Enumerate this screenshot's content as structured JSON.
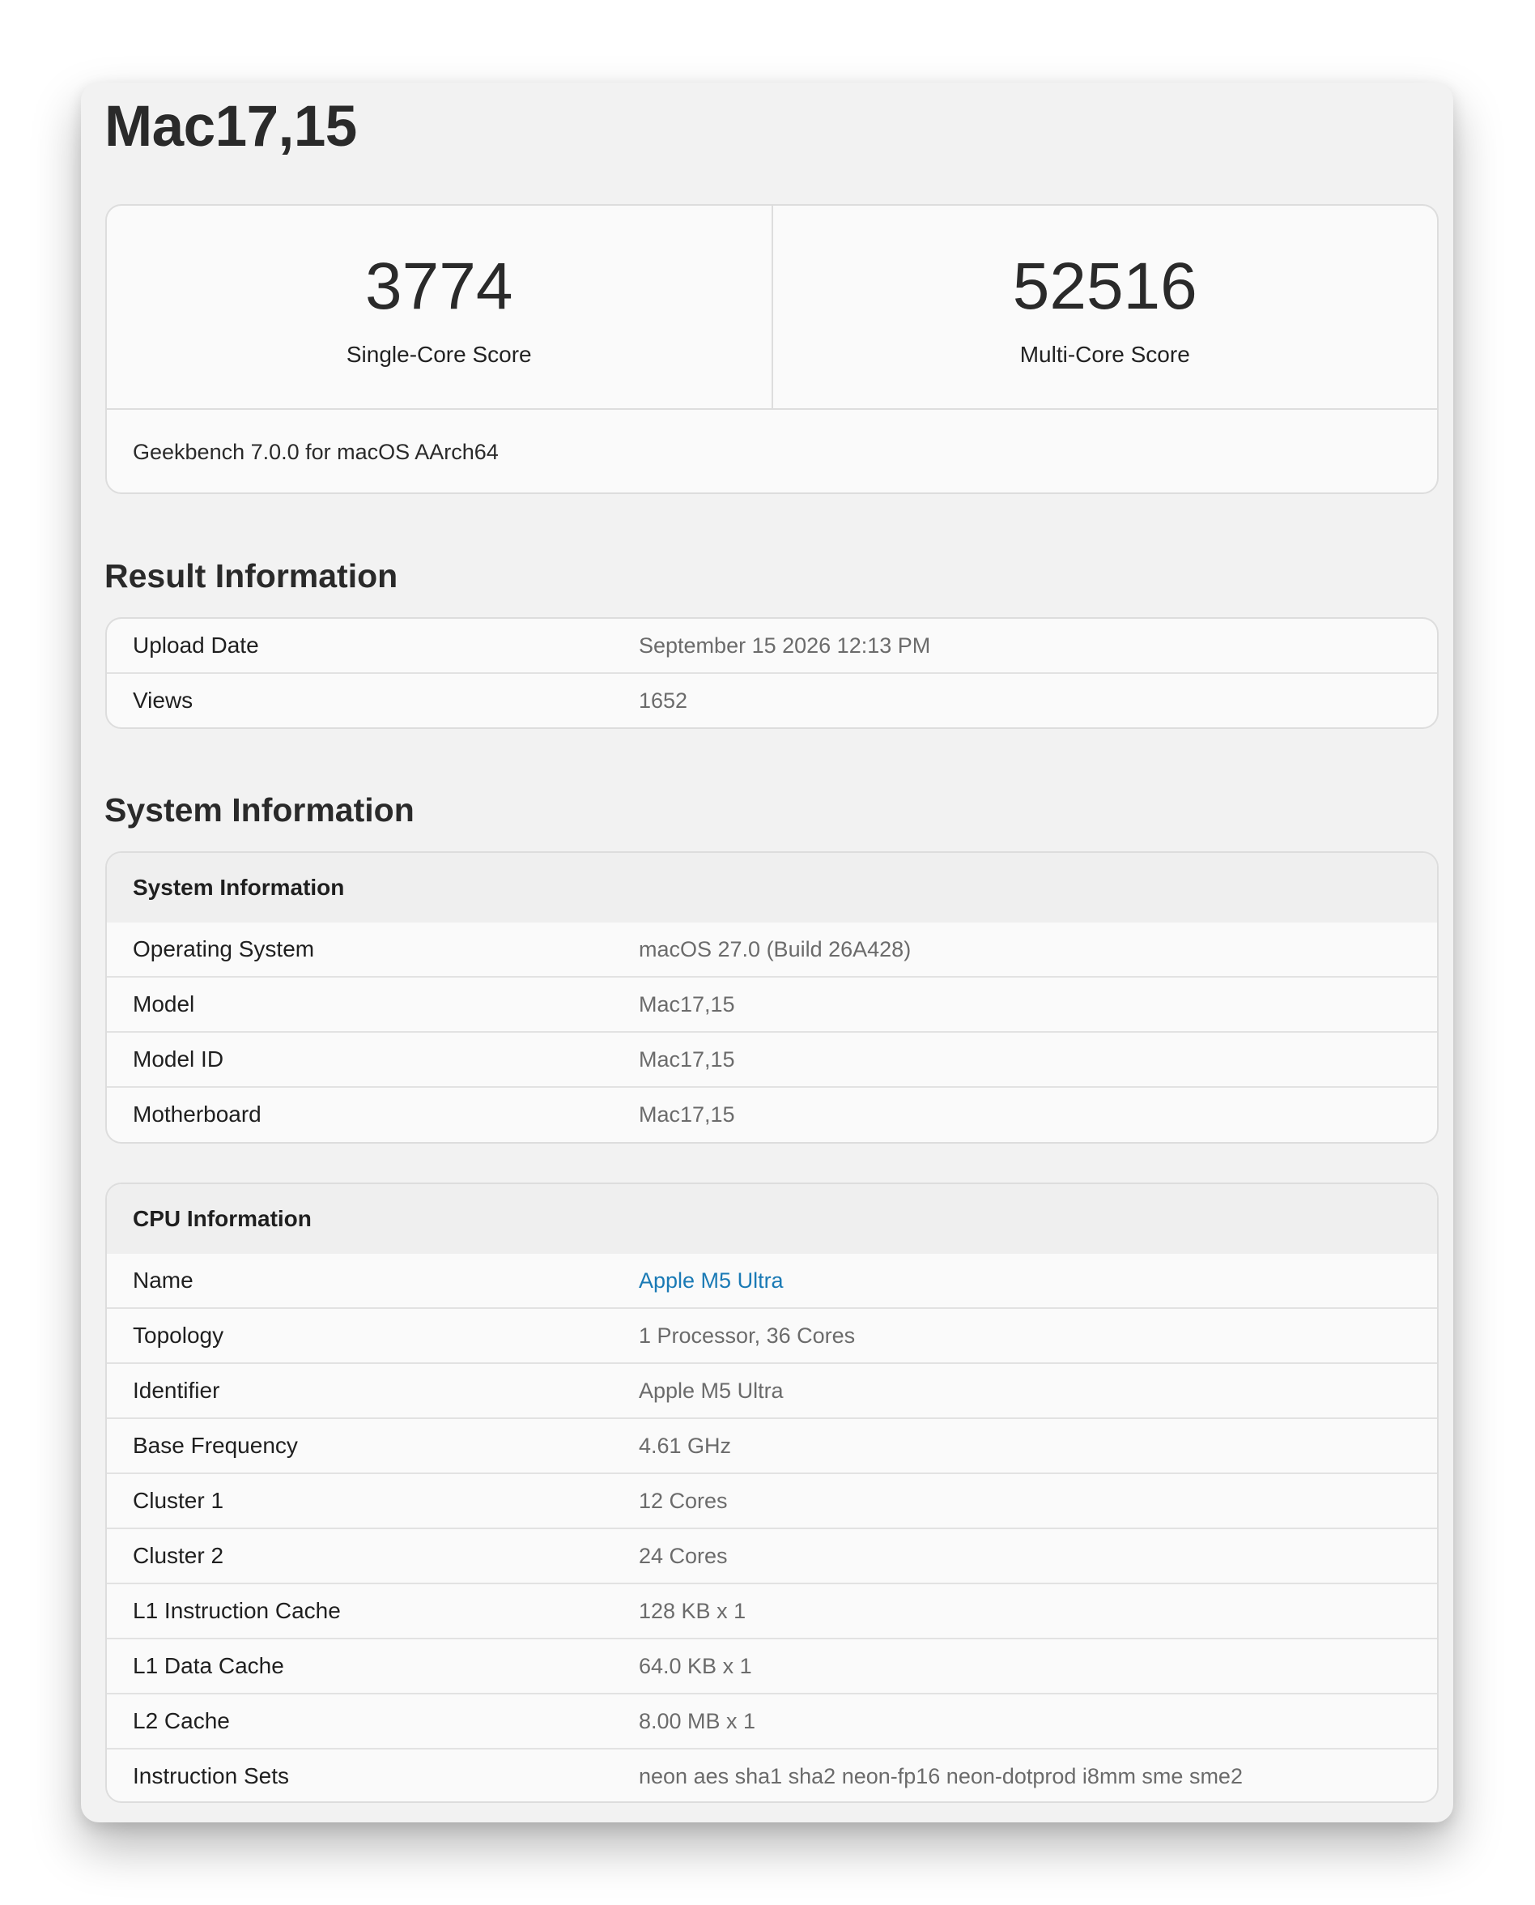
{
  "page": {
    "title": "Mac17,15"
  },
  "scores": {
    "single_core": {
      "value": "3774",
      "label": "Single-Core Score"
    },
    "multi_core": {
      "value": "52516",
      "label": "Multi-Core Score"
    },
    "version": "Geekbench 7.0.0 for macOS AArch64"
  },
  "result_info": {
    "heading": "Result Information",
    "rows": [
      {
        "label": "Upload Date",
        "value": "September 15 2026 12:13 PM"
      },
      {
        "label": "Views",
        "value": "1652"
      }
    ]
  },
  "system_info": {
    "heading": "System Information",
    "table_title": "System Information",
    "rows": [
      {
        "label": "Operating System",
        "value": "macOS 27.0 (Build 26A428)"
      },
      {
        "label": "Model",
        "value": "Mac17,15"
      },
      {
        "label": "Model ID",
        "value": "Mac17,15"
      },
      {
        "label": "Motherboard",
        "value": "Mac17,15"
      }
    ]
  },
  "cpu_info": {
    "table_title": "CPU Information",
    "rows": [
      {
        "label": "Name",
        "value": "Apple M5 Ultra"
      },
      {
        "label": "Topology",
        "value": "1 Processor, 36 Cores"
      },
      {
        "label": "Identifier",
        "value": "Apple M5 Ultra"
      },
      {
        "label": "Base Frequency",
        "value": "4.61 GHz"
      },
      {
        "label": "Cluster 1",
        "value": "12 Cores"
      },
      {
        "label": "Cluster 2",
        "value": "24 Cores"
      },
      {
        "label": "L1 Instruction Cache",
        "value": "128 KB x 1"
      },
      {
        "label": "L1 Data Cache",
        "value": "64.0 KB x 1"
      },
      {
        "label": "L2 Cache",
        "value": "8.00 MB x 1"
      },
      {
        "label": "Instruction Sets",
        "value": "neon aes sha1 sha2 neon-fp16 neon-dotprod i8mm sme sme2"
      }
    ]
  },
  "colors": {
    "link": "#1a7ab5",
    "card_background": "#f2f2f2",
    "panel_background": "#fafafa",
    "table_header_background": "#efefef"
  }
}
